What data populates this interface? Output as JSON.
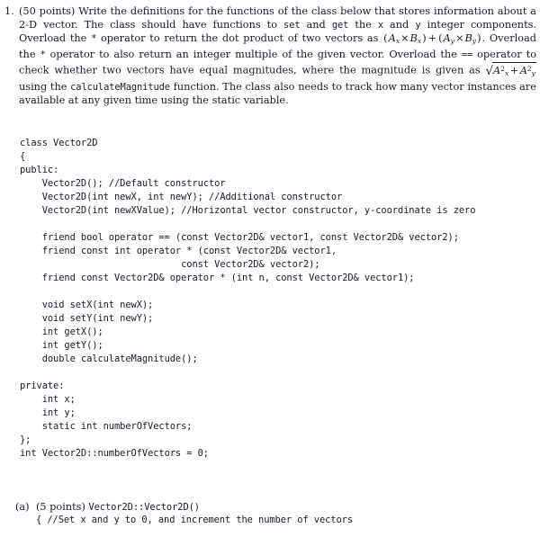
{
  "document": {
    "background_color": "#ffffff",
    "text_color": "#1a1a26"
  },
  "problem": {
    "number": "1.",
    "points_label": "(50 points)",
    "prose_segments": {
      "p1": "(50 points) Write the definitions for the functions of the class below that stores infor­mation about a 2-D vector. The class should have functions to ",
      "set_kw": "set",
      "p2": " and ",
      "get_kw": "get",
      "p3": " the ",
      "x_kw": "x",
      "p4": " and ",
      "y_kw": "y",
      "p5": " integer components. Overload the ",
      "star_kw_1": "*",
      "p6": " operator to return the dot product of two vectors as ",
      "formula_dot": "(Aₓ × Bₓ) + (Aᵧ × Bᵧ)",
      "p7": ". Overload the ",
      "star_kw_2": "*",
      "p8": " operator to also return an integer multiple of the given vector. Overload the ",
      "eq_kw": "==",
      "p9": " operator to check whether two vectors have equal magnitudes, where the magnitude is given as ",
      "formula_magnitude": "√(Aₓ² + Aᵧ²)",
      "p10": " using the ",
      "calc_kw": "calculateMagnitude",
      "p11": " function. The class also needs to track how many vector instances are available at any given time using the static variable."
    },
    "math": {
      "dot_product": {
        "open1": "(",
        "A1": "A",
        "A1sub": "x",
        "times1": "×",
        "B1": "B",
        "B1sub": "x",
        "close1": ")",
        "plus": "+",
        "open2": "(",
        "A2": "A",
        "A2sub": "y",
        "times2": "×",
        "B2": "B",
        "B2sub": "y",
        "close2": ")"
      },
      "magnitude": {
        "radical": "√",
        "term1_base": "A",
        "term1_sub": "x",
        "term1_sup": "2",
        "plus": "+",
        "term2_base": "A",
        "term2_sub": "y",
        "term2_sup": "2"
      }
    }
  },
  "code": {
    "lines": [
      "class Vector2D",
      "{",
      "public:",
      "    Vector2D(); //Default constructor",
      "    Vector2D(int newX, int newY); //Additional constructor",
      "    Vector2D(int newXValue); //Horizontal vector constructor, y-coordinate is zero",
      "",
      "    friend bool operator == (const Vector2D& vector1, const Vector2D& vector2);",
      "    friend const int operator * (const Vector2D& vector1,",
      "                             const Vector2D& vector2);",
      "    friend const Vector2D& operator * (int n, const Vector2D& vector1);",
      "",
      "    void setX(int newX);",
      "    void setY(int newY);",
      "    int getX();",
      "    int getY();",
      "    double calculateMagnitude();",
      "",
      "private:",
      "    int x;",
      "    int y;",
      "    static int numberOfVectors;",
      "};",
      "int Vector2D::numberOfVectors = 0;"
    ]
  },
  "subitem": {
    "label": "(a)",
    "points_label": "(5 points)",
    "signature": "Vector2D::Vector2D()",
    "code_line": "{ //Set x and y to 0, and increment the number of vectors"
  }
}
